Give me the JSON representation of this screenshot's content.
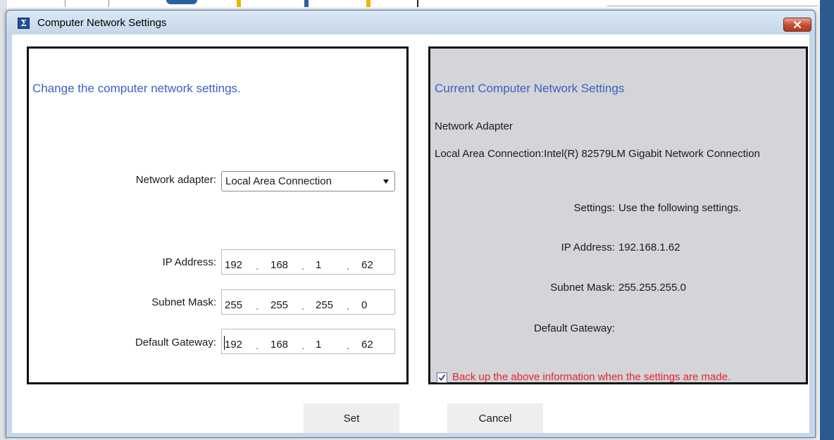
{
  "window": {
    "title": "Computer Network Settings",
    "icon": "sigma-app-icon",
    "close_icon": "close-icon"
  },
  "left_panel": {
    "heading": "Change the computer network settings.",
    "adapter_label": "Network adapter:",
    "adapter_value": "Local Area Connection",
    "ip_label": "IP Address:",
    "ip_octets": [
      "192",
      "168",
      "1",
      "62"
    ],
    "subnet_label": "Subnet Mask:",
    "subnet_octets": [
      "255",
      "255",
      "255",
      "0"
    ],
    "gateway_label": "Default Gateway:",
    "gateway_octets": [
      "192",
      "168",
      "1",
      "62"
    ]
  },
  "right_panel": {
    "heading": "Current Computer Network Settings",
    "adapter_header": "Network Adapter",
    "adapter_detail": "Local Area Connection:Intel(R) 82579LM Gigabit Network Connection",
    "settings_label": "Settings:",
    "settings_value": "Use the following settings.",
    "ip_label": "IP Address:",
    "ip_value": "192.168.1.62",
    "subnet_label": "Subnet Mask:",
    "subnet_value": "255.255.255.0",
    "gateway_label": "Default Gateway:",
    "gateway_value": "",
    "backup_checked": true,
    "backup_text": "Back up the above information when the settings are made."
  },
  "buttons": {
    "set_label": "Set",
    "cancel_label": "Cancel"
  },
  "colors": {
    "heading_blue": "#3c5fc2",
    "warning_red": "#e8232f",
    "right_panel_bg": "#d3d5d9"
  }
}
